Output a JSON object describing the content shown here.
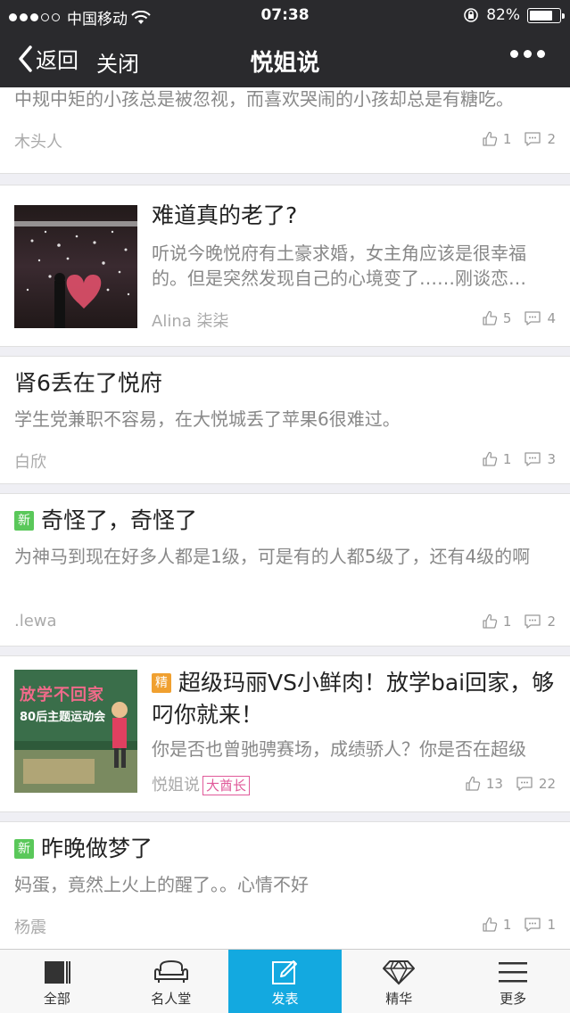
{
  "status_bar": {
    "carrier": "中国移动",
    "time": "07:38",
    "battery_percent": "82%",
    "battery_level": 0.82
  },
  "nav": {
    "back_label": "返回",
    "close_label": "关闭",
    "title": "悦姐说"
  },
  "posts": [
    {
      "excerpt": "中规中矩的小孩总是被忽视，而喜欢哭闹的小孩却总是有糖吃。",
      "author": "木头人",
      "likes": "1",
      "comments": "2"
    },
    {
      "title": "难道真的老了?",
      "excerpt": "听说今晚悦府有土豪求婚，女主角应该是很幸福的。但是突然发现自己的心境变了……刚谈恋…",
      "author": "Alina 柒柒",
      "likes": "5",
      "comments": "4"
    },
    {
      "title": "肾6丢在了悦府",
      "excerpt": "学生党兼职不容易，在大悦城丢了苹果6很难过。",
      "author": "白欣",
      "likes": "1",
      "comments": "3"
    },
    {
      "badge": "新",
      "title": "奇怪了，奇怪了",
      "excerpt": "为神马到现在好多人都是1级，可是有的人都5级了，还有4级的啊",
      "author": ".lewa",
      "likes": "1",
      "comments": "2"
    },
    {
      "badge": "精",
      "title": "超级玛丽VS小鲜肉！放学bai回家，够叼你就来！",
      "excerpt": "你是否也曾驰骋赛场，成绩骄人？你是否在超级",
      "author": "悦姐说",
      "rank": "大酋长",
      "thumb_text_1": "放学不回家",
      "thumb_text_2": "80后主题运动会",
      "likes": "13",
      "comments": "22"
    },
    {
      "badge": "新",
      "title": "昨晚做梦了",
      "excerpt": "妈蛋，竟然上火上的醒了。。心情不好",
      "author": "杨震",
      "likes": "1",
      "comments": "1"
    }
  ],
  "tabs": [
    {
      "label": "全部",
      "icon": "all-icon"
    },
    {
      "label": "名人堂",
      "icon": "sofa-icon"
    },
    {
      "label": "发表",
      "icon": "compose-icon"
    },
    {
      "label": "精华",
      "icon": "diamond-icon"
    },
    {
      "label": "更多",
      "icon": "menu-icon"
    }
  ],
  "colors": {
    "nav_bg": "#2a2a2d",
    "tab_active": "#13a9e0",
    "badge_new": "#5ac85a",
    "badge_jing": "#f0a030",
    "rank_pink": "#e05a9a"
  }
}
